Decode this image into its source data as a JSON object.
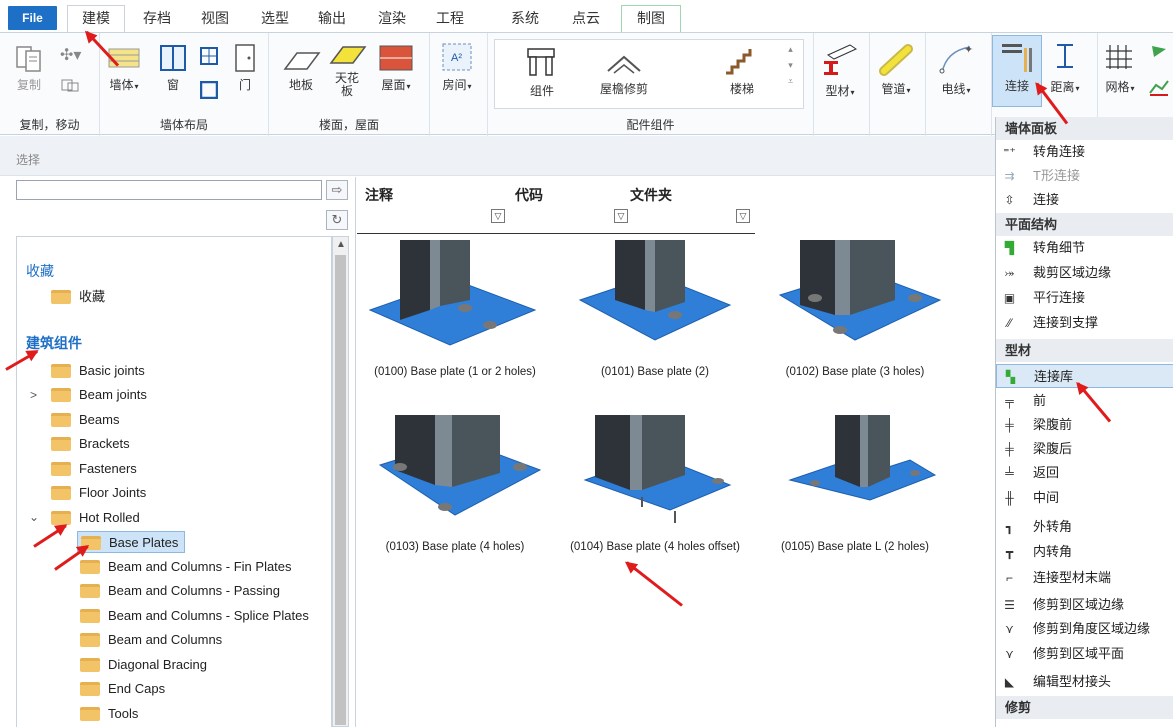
{
  "menu": {
    "tabs": [
      "File",
      "建模",
      "存档",
      "视图",
      "选型",
      "输出",
      "渲染",
      "工程",
      "系统",
      "点云",
      "制图"
    ]
  },
  "ribbon": {
    "copy_label": "复制",
    "copy_group": "复制，移动",
    "wall_label": "墙体",
    "window_label": "窗",
    "door_label": "门",
    "wall_group": "墙体布局",
    "floor_label": "地板",
    "ceiling_label": "天花板",
    "roof_label": "屋面",
    "floor_group": "楼面，屋面",
    "room_label": "房间",
    "component_label": "组件",
    "eave_label": "屋檐修剪",
    "stair_label": "楼梯",
    "parts_group": "配件组件",
    "profile_label": "型材",
    "pipe_label": "管道",
    "wire_label": "电线",
    "connect_label": "连接",
    "distance_label": "距离",
    "grid_label": "网格"
  },
  "selection": {
    "label": "选择"
  },
  "tree": {
    "favorites_section": "收藏",
    "favorites_folder": "收藏",
    "building_section": "建筑组件",
    "items": [
      "Basic joints",
      "Beam joints",
      "Beams",
      "Brackets",
      "Fasteners",
      "Floor Joints",
      "Hot Rolled"
    ],
    "sub_items": [
      "Base Plates",
      "Beam and Columns - Fin Plates",
      "Beam and Columns - Passing",
      "Beam and Columns - Splice Plates",
      "Beam and Columns",
      "Diagonal Bracing",
      "End Caps",
      "Tools"
    ]
  },
  "grid": {
    "columns": [
      "注释",
      "代码",
      "文件夹"
    ],
    "cards": [
      "(0100) Base plate (1 or 2 holes)",
      "(0101) Base plate (2)",
      "(0102) Base plate (3 holes)",
      "(0103) Base plate (4 holes)",
      "(0104) Base plate (4 holes offset)",
      "(0105) Base plate L (2 holes)"
    ]
  },
  "dropdown": {
    "h1": "墙体面板",
    "g1": [
      "转角连接",
      "T形连接",
      "连接"
    ],
    "h2": "平面结构",
    "g2": [
      "转角细节",
      "裁剪区域边缘",
      "平行连接",
      "连接到支撑"
    ],
    "h3": "型材",
    "g3": [
      "连接库",
      "前",
      "梁腹前",
      "梁腹后",
      "返回",
      "中间",
      "外转角",
      "内转角",
      "连接型材末端",
      "修剪到区域边缘",
      "修剪到角度区域边缘",
      "修剪到区域平面",
      "编辑型材接头"
    ],
    "h4": "修剪"
  },
  "colors": {
    "accent": "#1e6fc6",
    "arrow": "#e01b1b",
    "plate": "#2f7fd8"
  }
}
